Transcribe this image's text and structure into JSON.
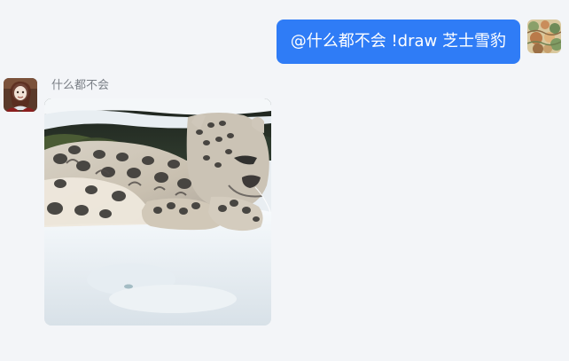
{
  "messages": {
    "outgoing": {
      "text": "@什么都不会 !draw 芝士雪豹",
      "avatar_icon": "user-avatar-icon"
    },
    "incoming": {
      "sender_name": "什么都不会",
      "avatar_icon": "bot-avatar-icon",
      "image_subject": "snow leopard lying in snow"
    }
  }
}
